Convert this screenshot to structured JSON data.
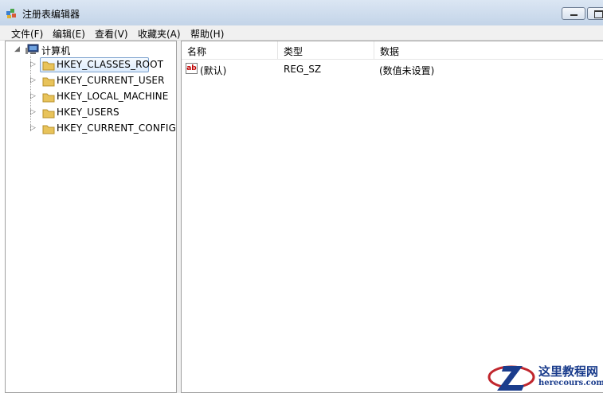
{
  "window": {
    "title": "注册表编辑器"
  },
  "menu": [
    "文件(F)",
    "编辑(E)",
    "查看(V)",
    "收藏夹(A)",
    "帮助(H)"
  ],
  "tree": {
    "root": "计算机",
    "items": [
      {
        "label": "HKEY_CLASSES_ROOT",
        "selected": true
      },
      {
        "label": "HKEY_CURRENT_USER"
      },
      {
        "label": "HKEY_LOCAL_MACHINE"
      },
      {
        "label": "HKEY_USERS"
      },
      {
        "label": "HKEY_CURRENT_CONFIG"
      }
    ]
  },
  "list": {
    "columns": [
      "名称",
      "类型",
      "数据"
    ],
    "rows": [
      {
        "name": "(默认)",
        "type": "REG_SZ",
        "data": "(数值未设置)",
        "icon": "string-value-icon"
      }
    ]
  },
  "watermark": {
    "cn": "这里教程网",
    "en": "herecours.com"
  },
  "colors": {
    "title_bar": "#c3d4e8",
    "selection_border": "#7da2ce",
    "folder": "#e8c35a",
    "logo": "#1a3c8c"
  }
}
